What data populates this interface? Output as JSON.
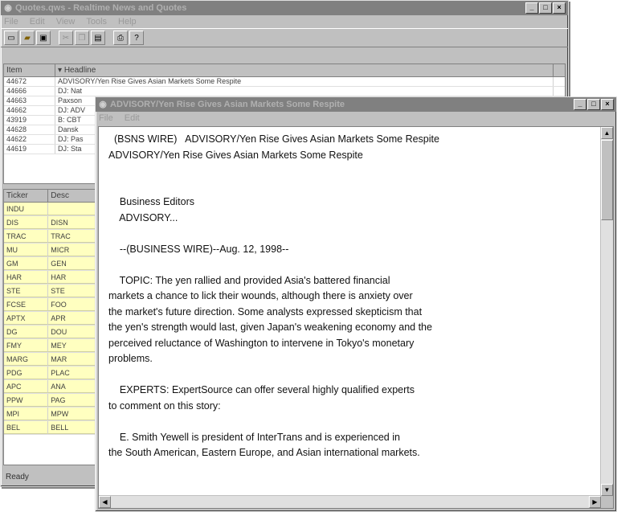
{
  "main_window": {
    "title": "Quotes.qws - Realtime News and Quotes",
    "menu": [
      "File",
      "Edit",
      "View",
      "Tools",
      "Help"
    ],
    "toolbar_icons": [
      "new-icon",
      "open-icon",
      "save-icon",
      "cut-icon",
      "copy-icon",
      "paste-icon",
      "print-icon",
      "help-icon"
    ],
    "news_columns": [
      "Item",
      "Headline"
    ],
    "news_rows": [
      {
        "item": "44672",
        "headline": "ADVISORY/Yen Rise Gives Asian Markets Some Respite"
      },
      {
        "item": "44666",
        "headline": "DJ: Nat"
      },
      {
        "item": "44663",
        "headline": "Paxson"
      },
      {
        "item": "44662",
        "headline": "DJ: ADV"
      },
      {
        "item": "43919",
        "headline": "B: CBT"
      },
      {
        "item": "44628",
        "headline": "Dansk"
      },
      {
        "item": "44622",
        "headline": "DJ: Pas"
      },
      {
        "item": "44619",
        "headline": "DJ: Sta"
      }
    ],
    "quote_columns": [
      "Ticker",
      "Desc"
    ],
    "quote_rows": [
      {
        "ticker": "INDU",
        "desc": ""
      },
      {
        "ticker": "DIS",
        "desc": "DISN"
      },
      {
        "ticker": "TRAC",
        "desc": "TRAC"
      },
      {
        "ticker": "MU",
        "desc": "MICR"
      },
      {
        "ticker": "GM",
        "desc": "GEN"
      },
      {
        "ticker": "HAR",
        "desc": "HAR"
      },
      {
        "ticker": "STE",
        "desc": "STE"
      },
      {
        "ticker": "FCSE",
        "desc": "FOO"
      },
      {
        "ticker": "APTX",
        "desc": "APR"
      },
      {
        "ticker": "DG",
        "desc": "DOU"
      },
      {
        "ticker": "FMY",
        "desc": "MEY"
      },
      {
        "ticker": "MARG",
        "desc": "MAR"
      },
      {
        "ticker": "PDG",
        "desc": "PLAC"
      },
      {
        "ticker": "APC",
        "desc": "ANA"
      },
      {
        "ticker": "PPW",
        "desc": "PAG"
      },
      {
        "ticker": "MPI",
        "desc": "MPW"
      },
      {
        "ticker": "BEL",
        "desc": "BELL"
      }
    ],
    "status": "Ready"
  },
  "story_window": {
    "title": "ADVISORY/Yen Rise Gives Asian Markets Some Respite",
    "menu": [
      "File",
      "Edit"
    ],
    "lines": [
      "  (BSNS WIRE)   ADVISORY/Yen Rise Gives Asian Markets Some Respite",
      "ADVISORY/Yen Rise Gives Asian Markets Some Respite",
      "",
      "",
      "    Business Editors",
      "    ADVISORY...",
      "",
      "    --(BUSINESS WIRE)--Aug. 12, 1998--",
      "",
      "    TOPIC: The yen rallied and provided Asia's battered financial",
      "markets a chance to lick their wounds, although there is anxiety over",
      "the market's future direction. Some analysts expressed skepticism that",
      "the yen's strength would last, given Japan's weakening economy and the",
      "perceived reluctance of Washington to intervene in Tokyo's monetary",
      "problems.",
      "",
      "    EXPERTS: ExpertSource can offer several highly qualified experts",
      "to comment on this story:",
      "",
      "    E. Smith Yewell is president of InterTrans and is experienced in",
      "the South American, Eastern Europe, and Asian international markets."
    ]
  }
}
